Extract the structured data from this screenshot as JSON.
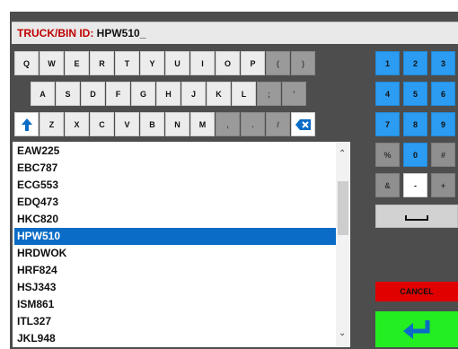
{
  "header": {
    "label": "TRUCK/BIN ID:",
    "value": "HPW510_"
  },
  "keyboard": {
    "row1": [
      "Q",
      "W",
      "E",
      "R",
      "T",
      "Y",
      "U",
      "I",
      "O",
      "P",
      "(",
      ")"
    ],
    "row2": [
      "A",
      "S",
      "D",
      "F",
      "G",
      "H",
      "J",
      "K",
      "L",
      ";",
      "'"
    ],
    "row3": [
      "Z",
      "X",
      "C",
      "V",
      "B",
      "N",
      "M",
      ",",
      ".",
      "/"
    ],
    "shift_icon": "arrow-up-icon",
    "backspace_icon": "backspace-icon"
  },
  "numpad": {
    "row1": [
      "1",
      "2",
      "3"
    ],
    "row2": [
      "4",
      "5",
      "6"
    ],
    "row3": [
      "7",
      "8",
      "9"
    ],
    "row4": [
      "%",
      "0",
      "#"
    ],
    "row5": [
      "&",
      "-",
      "+"
    ]
  },
  "list": {
    "items": [
      "EAW225",
      "EBC787",
      "ECG553",
      "EDQ473",
      "HKC820",
      "HPW510",
      "HRDWOK",
      "HRF824",
      "HSJ343",
      "ISM861",
      "ITL327",
      "JKL948"
    ],
    "selected": "HPW510"
  },
  "actions": {
    "cancel_label": "CANCEL",
    "enter_icon": "enter-icon"
  },
  "colors": {
    "numpad_blue": "#2b9cf2",
    "selection_blue": "#0a6cc6",
    "cancel_red": "#e00000",
    "enter_green": "#22ee22"
  }
}
